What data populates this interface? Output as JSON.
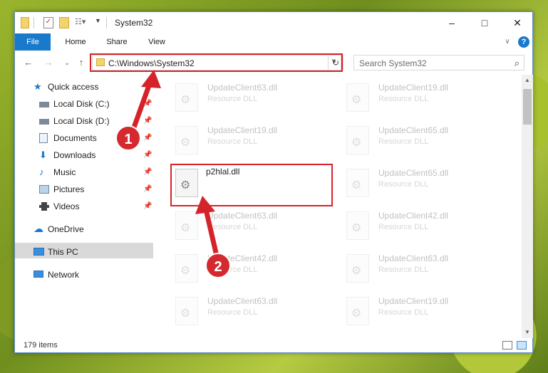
{
  "window": {
    "title": "System32",
    "controls": {
      "minimize": "–",
      "maximize": "□",
      "close": "✕"
    }
  },
  "ribbon": {
    "tabs": [
      {
        "label": "File"
      },
      {
        "label": "Home"
      },
      {
        "label": "Share"
      },
      {
        "label": "View"
      }
    ],
    "help_icon": "?"
  },
  "address": {
    "path": "C:\\Windows\\System32",
    "search_placeholder": "Search System32"
  },
  "nav": {
    "items": [
      {
        "label": "Quick access",
        "icon": "star-icon"
      },
      {
        "label": "Local Disk (C:)",
        "icon": "drive-icon",
        "pinned": true
      },
      {
        "label": "Local Disk (D:)",
        "icon": "drive-icon",
        "pinned": true
      },
      {
        "label": "Documents",
        "icon": "document-icon",
        "pinned": true
      },
      {
        "label": "Downloads",
        "icon": "download-icon",
        "pinned": true
      },
      {
        "label": "Music",
        "icon": "music-icon",
        "pinned": true
      },
      {
        "label": "Pictures",
        "icon": "picture-icon",
        "pinned": true
      },
      {
        "label": "Videos",
        "icon": "video-icon",
        "pinned": true
      },
      {
        "label": "OneDrive",
        "icon": "cloud-icon"
      },
      {
        "label": "This PC",
        "icon": "computer-icon",
        "selected": true
      },
      {
        "label": "Network",
        "icon": "network-icon"
      }
    ]
  },
  "files": {
    "left": [
      {
        "name": "UpdateClient63.dll",
        "type": "Resource DLL",
        "faded": true
      },
      {
        "name": "UpdateClient19.dll",
        "type": "Resource DLL",
        "faded": true
      },
      {
        "name": "p2hlal.dll",
        "type": "",
        "faded": false
      },
      {
        "name": "UpdateClient63.dll",
        "type": "Resource DLL",
        "faded": true
      },
      {
        "name": "UpdateClient42.dll",
        "type": "Resource DLL",
        "faded": true
      },
      {
        "name": "UpdateClient63.dll",
        "type": "Resource DLL",
        "faded": true
      },
      {
        "name": "",
        "type": "",
        "faded": true
      }
    ],
    "right": [
      {
        "name": "UpdateClient19.dll",
        "type": "Resource DLL",
        "faded": true
      },
      {
        "name": "UpdateClient65.dll",
        "type": "Resource DLL",
        "faded": true
      },
      {
        "name": "UpdateClient65.dll",
        "type": "Resource DLL",
        "faded": true
      },
      {
        "name": "UpdateClient42.dll",
        "type": "Resource DLL",
        "faded": true
      },
      {
        "name": "UpdateClient63.dll",
        "type": "Resource DLL",
        "faded": true
      },
      {
        "name": "UpdateClient19.dll",
        "type": "Resource DLL",
        "faded": true
      },
      {
        "name": "",
        "type": "",
        "faded": true
      }
    ]
  },
  "status": {
    "item_count": "179 items"
  },
  "annotations": {
    "step1": "1",
    "step2": "2",
    "color": "#d6232a"
  }
}
